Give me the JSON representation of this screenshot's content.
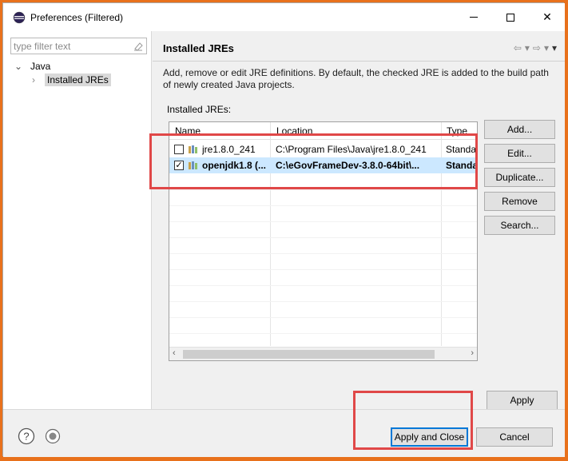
{
  "window": {
    "title": "Preferences (Filtered)"
  },
  "left": {
    "filter_placeholder": "type filter text",
    "tree": {
      "java": "Java",
      "installed_jres": "Installed JREs"
    }
  },
  "right": {
    "page_title": "Installed JREs",
    "description": "Add, remove or edit JRE definitions. By default, the checked JRE is added to the build path of newly created Java projects.",
    "installed_label": "Installed JREs:",
    "columns": [
      "Name",
      "Location",
      "Type"
    ],
    "rows": [
      {
        "name": "jre1.8.0_241",
        "location": "C:\\Program Files\\Java\\jre1.8.0_241",
        "type": "Standa",
        "checked": false,
        "selected": false
      },
      {
        "name": "openjdk1.8 (...",
        "location": "C:\\eGovFrameDev-3.8.0-64bit\\...",
        "type": "Standa",
        "checked": true,
        "selected": true
      }
    ],
    "buttons": {
      "add": "Add...",
      "edit": "Edit...",
      "duplicate": "Duplicate...",
      "remove": "Remove",
      "search": "Search...",
      "apply": "Apply"
    }
  },
  "footer": {
    "apply_and_close": "Apply and Close",
    "cancel": "Cancel"
  },
  "icons": {
    "app": "eclipse-icon",
    "help": "help-icon",
    "prefs": "import-export-icon"
  },
  "colors": {
    "selection": "#cce8ff",
    "highlight_red": "#e04848",
    "frame_orange": "#e8711c"
  }
}
